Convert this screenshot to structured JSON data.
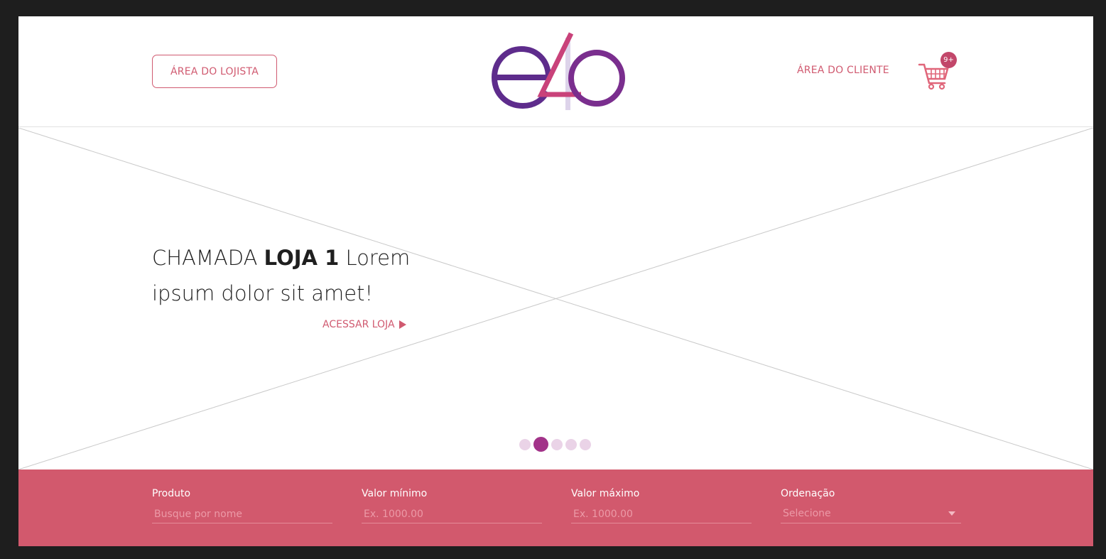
{
  "header": {
    "merchant_button": "ÁREA DO LOJISTA",
    "logo_text": "e4o",
    "client_link": "ÁREA DO CLIENTE",
    "cart_badge": "9+"
  },
  "hero": {
    "headline_pre": "CHAMADA ",
    "headline_bold": "LOJA 1",
    "headline_post": " Lorem ipsum dolor sit amet!",
    "cta": "ACESSAR LOJA",
    "slides_total": 5,
    "active_slide": 2
  },
  "filters": {
    "produto": {
      "label": "Produto",
      "placeholder": "Busque por nome"
    },
    "valor_minimo": {
      "label": "Valor mínimo",
      "placeholder": "Ex. 1000.00"
    },
    "valor_maximo": {
      "label": "Valor máximo",
      "placeholder": "Ex. 1000.00"
    },
    "ordenacao": {
      "label": "Ordenação",
      "selected": "Selecione"
    }
  },
  "colors": {
    "brand_pink": "#d05a70",
    "brand_purple": "#6a2c8c",
    "filter_bar": "#d2596d",
    "active_dot": "#a23389"
  }
}
